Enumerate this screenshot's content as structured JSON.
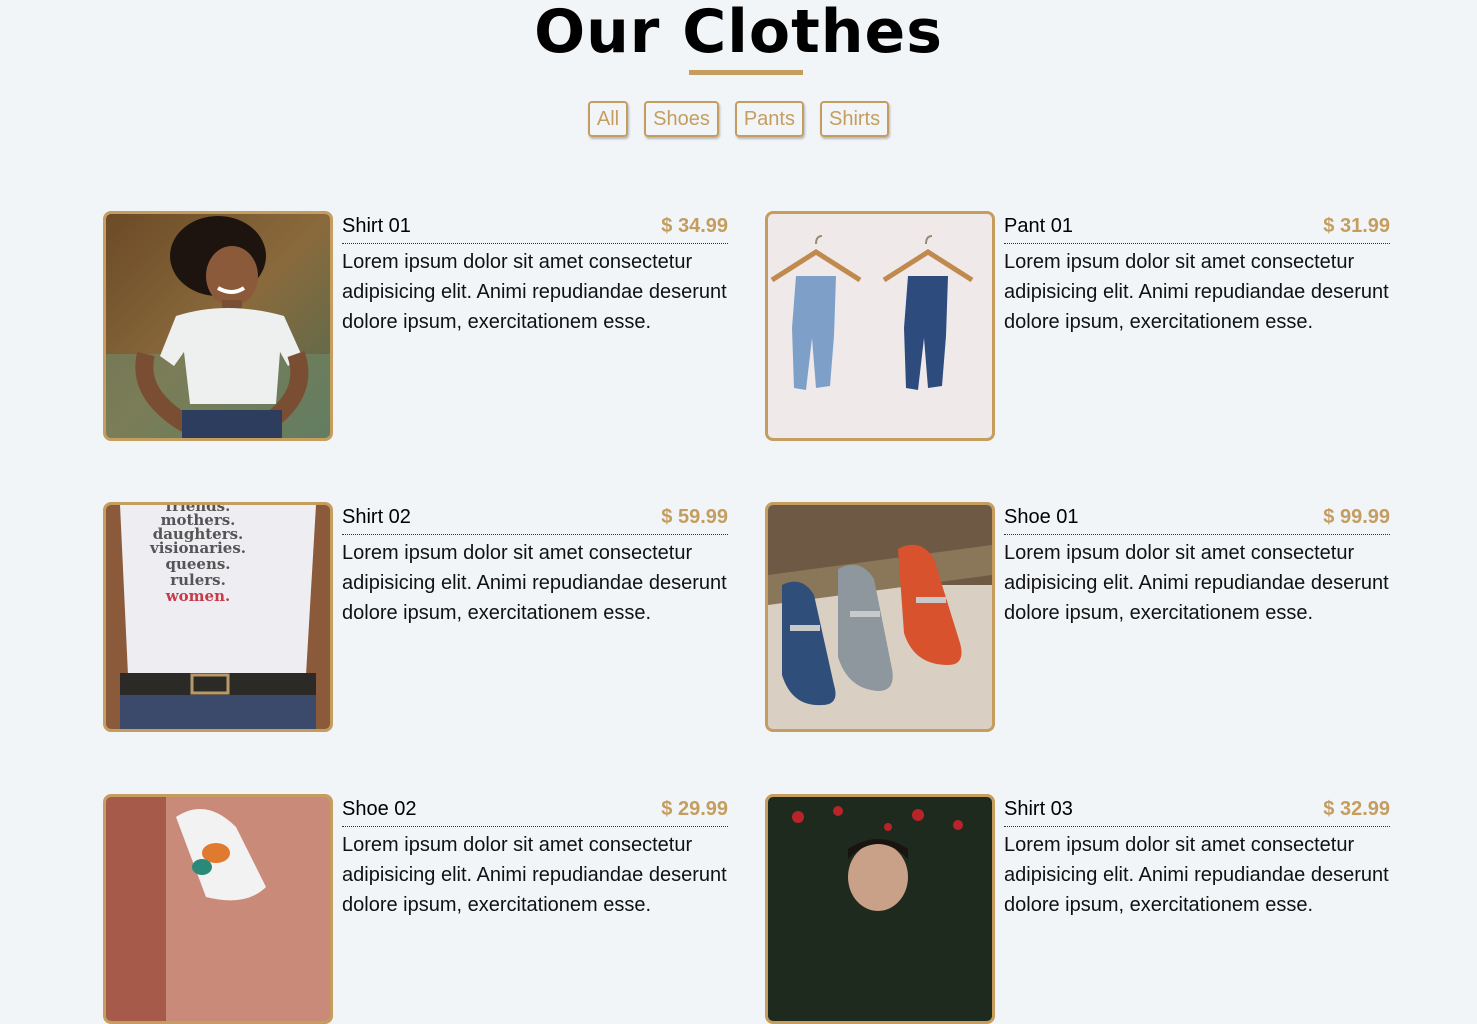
{
  "header": {
    "title": "Our Clothes"
  },
  "filters": [
    {
      "label": "All"
    },
    {
      "label": "Shoes"
    },
    {
      "label": "Pants"
    },
    {
      "label": "Shirts"
    }
  ],
  "items": [
    {
      "name": "Shirt 01",
      "price": "$ 34.99",
      "desc": "Lorem ipsum dolor sit amet consectetur adipisicing elit. Animi repudiandae deserunt dolore ipsum, exercitationem esse."
    },
    {
      "name": "Pant 01",
      "price": "$ 31.99",
      "desc": "Lorem ipsum dolor sit amet consectetur adipisicing elit. Animi repudiandae deserunt dolore ipsum, exercitationem esse."
    },
    {
      "name": "Shirt 02",
      "price": "$ 59.99",
      "desc": "Lorem ipsum dolor sit amet consectetur adipisicing elit. Animi repudiandae deserunt dolore ipsum, exercitationem esse."
    },
    {
      "name": "Shoe 01",
      "price": "$ 99.99",
      "desc": "Lorem ipsum dolor sit amet consectetur adipisicing elit. Animi repudiandae deserunt dolore ipsum, exercitationem esse."
    },
    {
      "name": "Shoe 02",
      "price": "$ 29.99",
      "desc": "Lorem ipsum dolor sit amet consectetur adipisicing elit. Animi repudiandae deserunt dolore ipsum, exercitationem esse."
    },
    {
      "name": "Shirt 03",
      "price": "$ 32.99",
      "desc": "Lorem ipsum dolor sit amet consectetur adipisicing elit. Animi repudiandae deserunt dolore ipsum, exercitationem esse."
    }
  ],
  "shirt_print": [
    "friends.",
    "mothers.",
    "daughters.",
    "visionaries.",
    "queens.",
    "rulers.",
    "women."
  ],
  "colors": {
    "accent": "#c59d5f",
    "background": "#f1f5f8"
  }
}
